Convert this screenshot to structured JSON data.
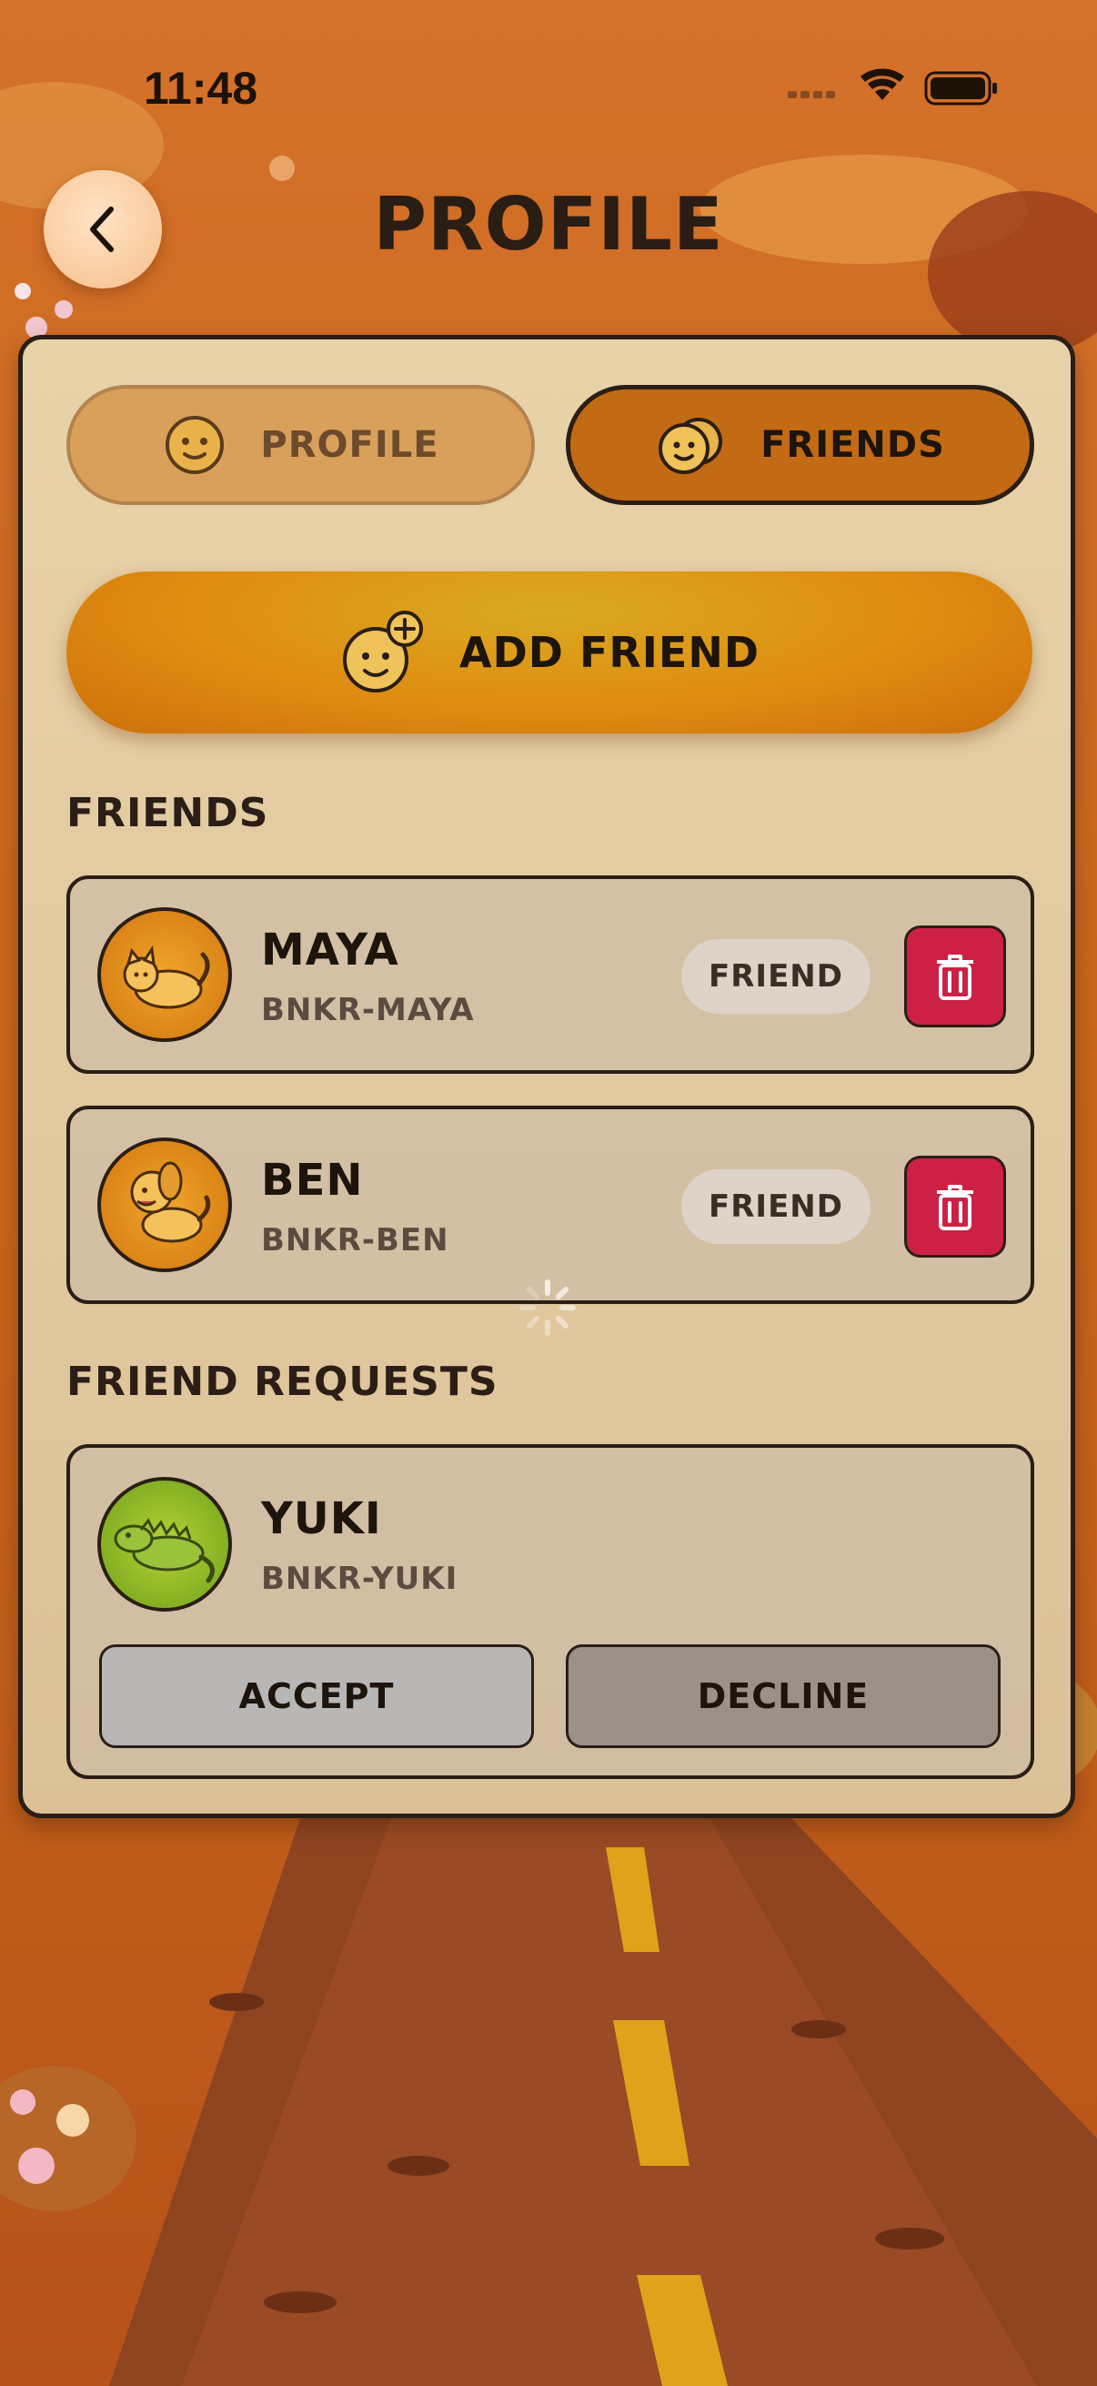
{
  "status_bar": {
    "time": "11:48"
  },
  "header": {
    "title": "PROFILE"
  },
  "tabs": [
    {
      "label": "PROFILE",
      "active": false
    },
    {
      "label": "FRIENDS",
      "active": true
    }
  ],
  "add_friend": {
    "label": "ADD FRIEND"
  },
  "friends_section": {
    "title": "FRIENDS",
    "items": [
      {
        "name": "MAYA",
        "handle": "BNKR-MAYA",
        "badge": "FRIEND",
        "avatar": "cat-icon"
      },
      {
        "name": "BEN",
        "handle": "BNKR-BEN",
        "badge": "FRIEND",
        "avatar": "dog-icon"
      }
    ]
  },
  "requests_section": {
    "title": "FRIEND REQUESTS",
    "items": [
      {
        "name": "YUKI",
        "handle": "BNKR-YUKI",
        "avatar": "iguana-icon",
        "accept_label": "ACCEPT",
        "decline_label": "DECLINE"
      }
    ]
  },
  "colors": {
    "accent_orange": "#c36a14",
    "delete_red": "#cc2144",
    "panel_bg": "#e8d2a8",
    "outline": "#2a1e16"
  }
}
